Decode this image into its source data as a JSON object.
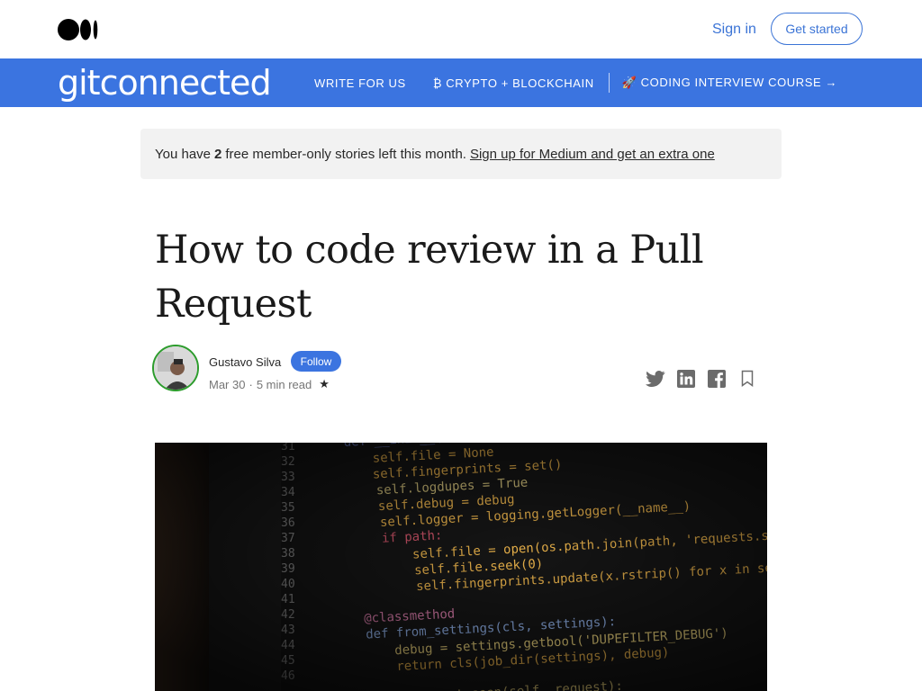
{
  "header": {
    "sign_in": "Sign in",
    "get_started": "Get started"
  },
  "publication": {
    "name": "gitconnected",
    "nav": [
      {
        "label": "WRITE FOR US"
      },
      {
        "label": "₿ CRYPTO + BLOCKCHAIN"
      },
      {
        "label": "🚀 CODING INTERVIEW COURSE →"
      }
    ]
  },
  "banner": {
    "prefix": "You have",
    "count": "2",
    "suffix": "free member-only stories left this month.",
    "link": "Sign up for Medium and get an extra one"
  },
  "article": {
    "title": "How to code review in a Pull Request",
    "author": "Gustavo Silva",
    "follow": "Follow",
    "date": "Mar 30",
    "dot": "·",
    "read_time": "5 min read",
    "star": "★"
  },
  "hero_code": {
    "line_numbers": [
      "31",
      "32",
      "33",
      "34",
      "35",
      "36",
      "37",
      "38",
      "39",
      "40",
      "41",
      "42",
      "43",
      "44",
      "45",
      "46"
    ],
    "lines": [
      "def __init__(self, path=None, debug=False):",
      "self.file = None",
      "self.fingerprints = set()",
      "self.logdupes = True",
      "self.debug = debug",
      "self.logger = logging.getLogger(__name__)",
      "if path:",
      "self.file = open(os.path.join(path, 'requests.seen'), 'a+')",
      "self.file.seek(0)",
      "self.fingerprints.update(x.rstrip() for x in self.file)",
      "",
      "@classmethod",
      "def from_settings(cls, settings):",
      "debug = settings.getbool('DUPEFILTER_DEBUG')",
      "return cls(job_dir(settings), debug)",
      "",
      "def request_seen(self, request):"
    ]
  }
}
